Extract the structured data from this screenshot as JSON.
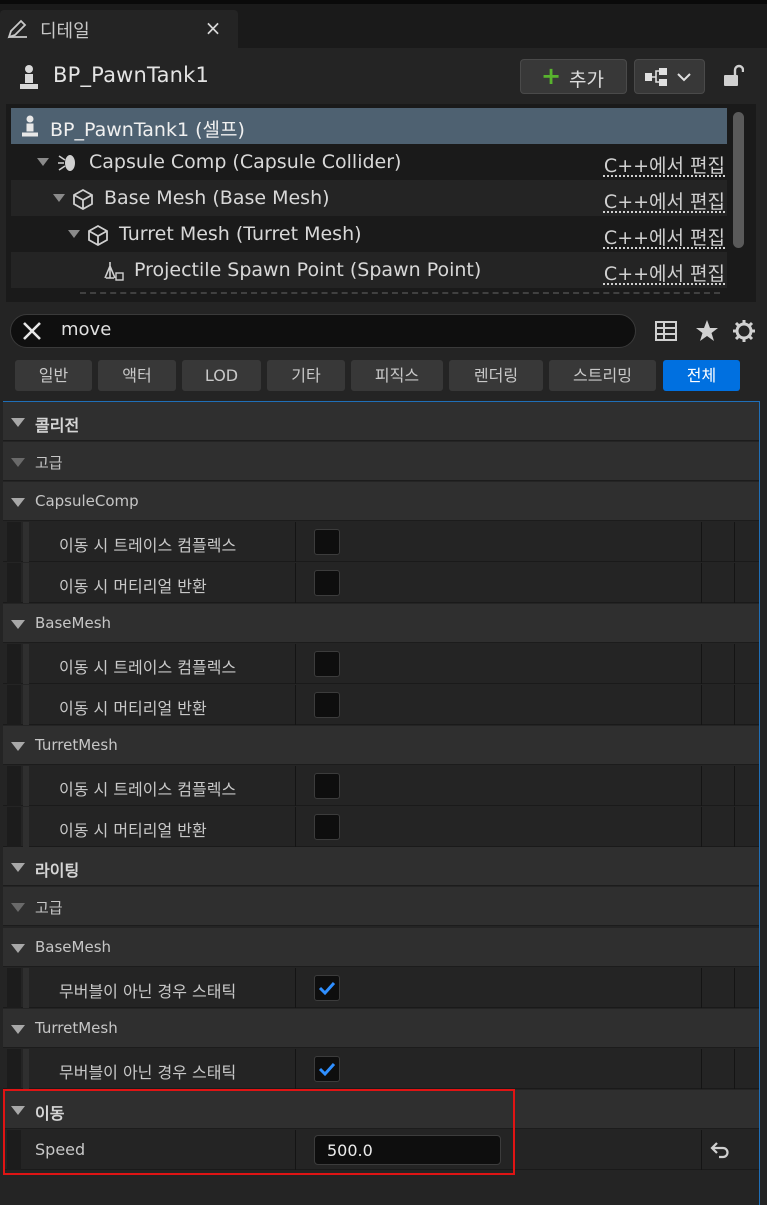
{
  "tab": {
    "title": "디테일",
    "close": "×"
  },
  "header": {
    "actor_name": "BP_PawnTank1",
    "add_label": "추가"
  },
  "tree": {
    "rows": [
      {
        "name": "BP_PawnTank1 (셀프)",
        "edit": ""
      },
      {
        "name": "Capsule Comp (Capsule Collider)",
        "edit": "C++에서 편집"
      },
      {
        "name": "Base Mesh (Base Mesh)",
        "edit": "C++에서 편집"
      },
      {
        "name": "Turret Mesh (Turret Mesh)",
        "edit": "C++에서 편집"
      },
      {
        "name": "Projectile Spawn Point (Spawn Point)",
        "edit": "C++에서 편집"
      }
    ]
  },
  "search": {
    "value": "move"
  },
  "filter_tabs": [
    "일반",
    "액터",
    "LOD",
    "기타",
    "피직스",
    "렌더링",
    "스트리밍",
    "전체"
  ],
  "sections": {
    "collision": "콜리전",
    "advanced1": "고급",
    "capsulecomp": "CapsuleComp",
    "basemesh1": "BaseMesh",
    "turretmesh1": "TurretMesh",
    "lighting": "라이팅",
    "advanced2": "고급",
    "basemesh2": "BaseMesh",
    "turretmesh2": "TurretMesh",
    "movement": "이동"
  },
  "props": {
    "trace_complex": "이동 시 트레이스 컴플렉스",
    "return_material": "이동 시 머티리얼 반환",
    "static_non_movable": "무버블이 아닌 경우 스태틱",
    "speed": "Speed",
    "speed_value": "500.0"
  },
  "colors": {
    "accent": "#0070e0",
    "selection": "#4e6171",
    "add_green": "#58b32e",
    "highlight": "#e01414"
  }
}
